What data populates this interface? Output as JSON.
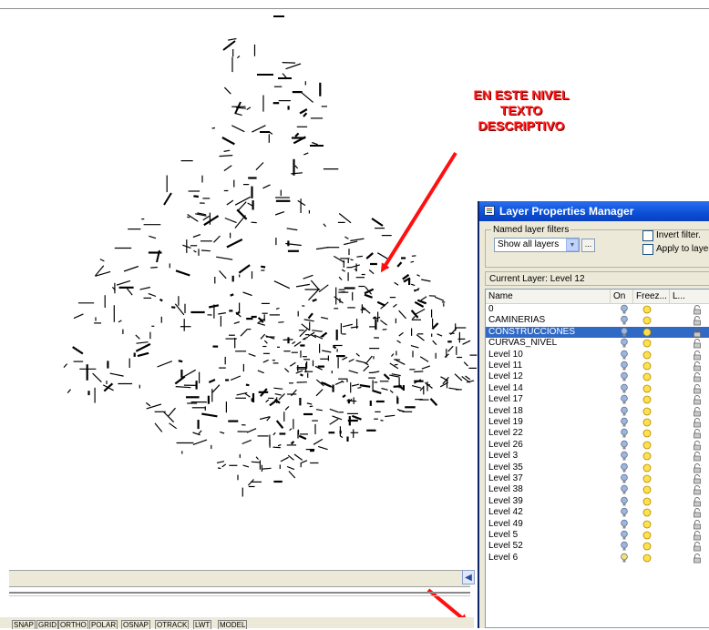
{
  "annotation": {
    "lines": [
      "EN ESTE NIVEL",
      "TEXTO",
      "DESCRIPTIVO"
    ],
    "color": "#ff1a1a"
  },
  "status_bar": {
    "buttons": [
      "SNAP",
      "GRID",
      "ORTHO",
      "POLAR",
      "OSNAP",
      "OTRACK",
      "LWT",
      "MODEL"
    ]
  },
  "layer_dialog": {
    "title": "Layer Properties Manager",
    "named_filters_label": "Named layer filters",
    "filter_value": "Show all layers",
    "invert_filter_label": "Invert filter.",
    "apply_to_layers_label": "Apply to layers",
    "current_layer_text": "Current Layer: Level 12",
    "columns": {
      "name": "Name",
      "on": "On",
      "freeze": "Freez...",
      "lock": "L..."
    },
    "layers": [
      "0",
      "CAMINERIAS",
      "CONSTRUCCIONES",
      "CURVAS_NIVEL",
      "Level 10",
      "Level 11",
      "Level 12",
      "Level 14",
      "Level 17",
      "Level 18",
      "Level 19",
      "Level 22",
      "Level 26",
      "Level 3",
      "Level 35",
      "Level 37",
      "Level 38",
      "Level 39",
      "Level 42",
      "Level 49",
      "Level 5",
      "Level 52",
      "Level 6"
    ],
    "selected_layer": "CONSTRUCCIONES",
    "bulb_off_layer": "Level 6",
    "colors": {
      "selection": "#316ac5",
      "bulb_on": "#9db6dc",
      "bulb_off": "#f4e26b",
      "sun": "#ffe04d"
    }
  },
  "icons": [
    "light-bulb-icon",
    "sun-icon",
    "lock-icon",
    "dropdown-arrow-icon",
    "browse-icon",
    "layers-icon",
    "arrow-left-icon"
  ]
}
